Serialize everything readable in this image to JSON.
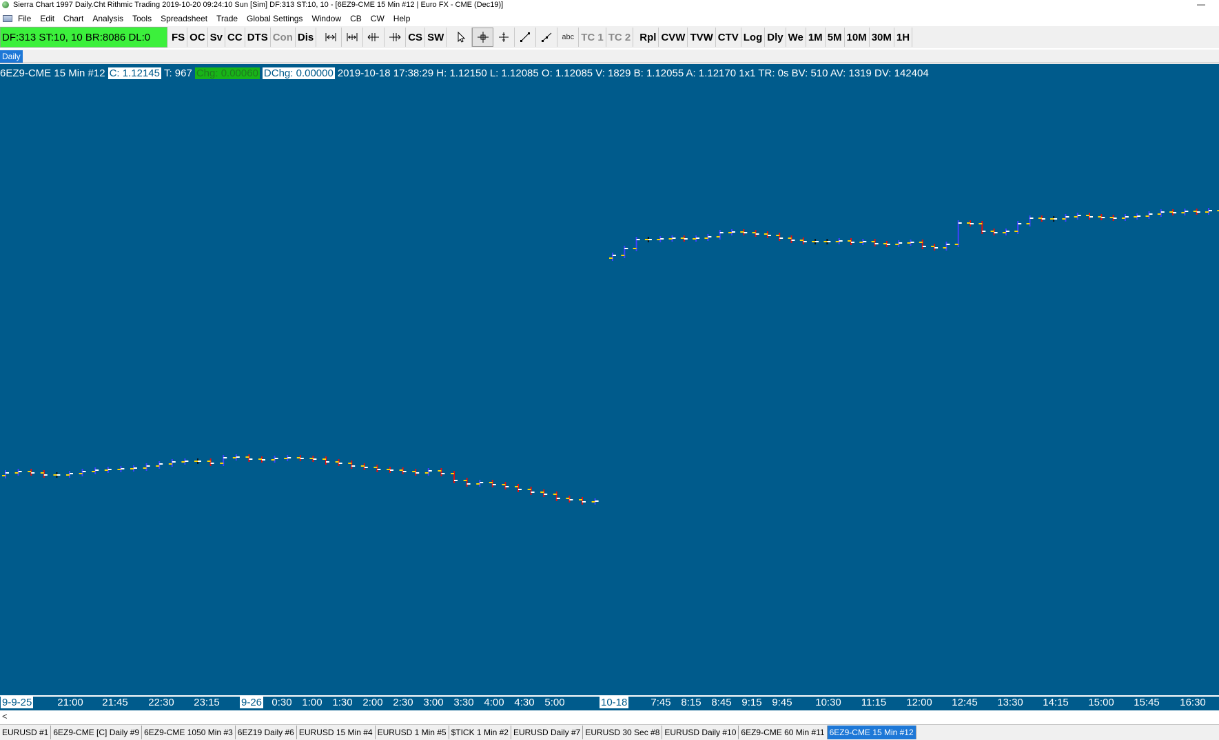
{
  "window": {
    "title": "Sierra Chart 1997 Daily.Cht  Rithmic Trading 2019-10-20  09:24:10 Sun [Sim]  DF:313  ST:10, 10 - [6EZ9-CME  15 Min  #12 | Euro FX - CME (Dec19)]",
    "minimize_glyph": "—"
  },
  "menu": [
    "File",
    "Edit",
    "Chart",
    "Analysis",
    "Tools",
    "Spreadsheet",
    "Trade",
    "Global Settings",
    "Window",
    "CB",
    "CW",
    "Help"
  ],
  "toolbar": {
    "status": "DF:313  ST:10, 10  BR:8086  DL:0",
    "status_color": "#3cf03c",
    "buttons_a": [
      {
        "label": "FS",
        "dim": false
      },
      {
        "label": "OC",
        "dim": false
      },
      {
        "label": "Sv",
        "dim": false
      },
      {
        "label": "CC",
        "dim": false
      },
      {
        "label": "DTS",
        "dim": false
      },
      {
        "label": "Con",
        "dim": true
      },
      {
        "label": "Dis",
        "dim": false
      }
    ],
    "icons": [
      "scale-range-icon",
      "scale-range-fixed-icon",
      "scroll-left-icon",
      "scroll-right-icon"
    ],
    "buttons_b": [
      {
        "label": "CS",
        "dim": false
      },
      {
        "label": "SW",
        "dim": false
      }
    ],
    "tools": [
      "pointer-icon",
      "crosshair-icon",
      "cursor-cross-icon",
      "draw-line-icon",
      "draw-ray-icon"
    ],
    "text_tool": "abc",
    "buttons_c": [
      {
        "label": "TC 1",
        "dim": true
      },
      {
        "label": "TC 2",
        "dim": true
      }
    ],
    "buttons_d": [
      {
        "label": "Rpl",
        "dim": false
      },
      {
        "label": "CVW",
        "dim": false
      },
      {
        "label": "TVW",
        "dim": false
      },
      {
        "label": "CTV",
        "dim": false
      },
      {
        "label": "Log",
        "dim": false
      },
      {
        "label": "Dly",
        "dim": false
      },
      {
        "label": "We",
        "dim": false
      },
      {
        "label": "1M",
        "dim": false
      },
      {
        "label": "5M",
        "dim": false
      },
      {
        "label": "10M",
        "dim": false
      },
      {
        "label": "30M",
        "dim": false
      },
      {
        "label": "1H",
        "dim": false
      }
    ]
  },
  "chart_tab": "Daily",
  "quote": {
    "symbol": "6EZ9-CME  15 Min  #12",
    "close": "C: 1.12145",
    "trades": "T: 967",
    "chg": "Chg: 0.00060",
    "dchg": "DChg: 0.00000",
    "details": "2019-10-18 17:38:29 H: 1.12150 L: 1.12085 O: 1.12085 V: 1829 B: 1.12055 A: 1.12170 1x1 TR: 0s BV: 510 AV: 1319 DV: 142404"
  },
  "colors": {
    "background": "#005b8c",
    "up": "#4040ff",
    "down": "#e01010",
    "neutral": "#111111",
    "open_tick": "#ffd400",
    "close_tick": "#ffffff"
  },
  "time_axis": [
    {
      "label": "9-9-25",
      "boxed": true
    },
    {
      "label": "21:00"
    },
    {
      "label": "21:45"
    },
    {
      "label": "22:30"
    },
    {
      "label": "23:15"
    },
    {
      "label": "9-26",
      "boxed": true
    },
    {
      "label": "0:30"
    },
    {
      "label": "1:00"
    },
    {
      "label": "1:30"
    },
    {
      "label": "2:00"
    },
    {
      "label": "2:30"
    },
    {
      "label": "3:00"
    },
    {
      "label": "3:30"
    },
    {
      "label": "4:00"
    },
    {
      "label": "4:30"
    },
    {
      "label": "5:00"
    },
    {
      "label": "10-18",
      "boxed": true
    },
    {
      "label": "7:45"
    },
    {
      "label": "8:15"
    },
    {
      "label": "8:45"
    },
    {
      "label": "9:15"
    },
    {
      "label": "9:45"
    },
    {
      "label": "10:30"
    },
    {
      "label": "11:15"
    },
    {
      "label": "12:00"
    },
    {
      "label": "12:45"
    },
    {
      "label": "13:30"
    },
    {
      "label": "14:15"
    },
    {
      "label": "15:00"
    },
    {
      "label": "15:45"
    },
    {
      "label": "16:30"
    }
  ],
  "scroll_arrow": "<",
  "bottom_tabs": [
    {
      "label": "EURUSD  #1"
    },
    {
      "label": "6EZ9-CME [C]  Daily  #9"
    },
    {
      "label": "6EZ9-CME  1050 Min  #3"
    },
    {
      "label": "6EZ19  Daily  #6"
    },
    {
      "label": "EURUSD  15 Min  #4"
    },
    {
      "label": "EURUSD  1 Min  #5"
    },
    {
      "label": "$TICK  1 Min  #2"
    },
    {
      "label": "EURUSD  Daily  #7"
    },
    {
      "label": "EURUSD  30 Sec  #8"
    },
    {
      "label": "EURUSD  Daily  #10"
    },
    {
      "label": "6EZ9-CME  60 Min  #11"
    },
    {
      "label": "6EZ9-CME  15 Min  #12",
      "active": true
    }
  ],
  "chart_data": {
    "type": "ohlc",
    "segments": [
      {
        "session": "9-25 / 9-26",
        "closes": [
          594,
          592,
          594,
          597,
          597,
          595,
          592,
          590,
          589,
          588,
          587,
          584,
          581,
          578,
          577,
          577,
          580,
          572,
          571,
          574,
          575,
          573,
          572,
          573,
          574,
          578,
          580,
          584,
          586,
          589,
          590,
          592,
          594,
          591,
          595,
          605,
          610,
          608,
          611,
          614,
          618,
          622,
          625,
          631,
          633,
          636,
          635
        ]
      },
      {
        "session": "10-18",
        "closes": [
          278,
          268,
          255,
          255,
          254,
          253,
          254,
          253,
          251,
          245,
          244,
          245,
          247,
          249,
          253,
          256,
          258,
          258,
          258,
          257,
          259,
          258,
          261,
          262,
          260,
          259,
          265,
          267,
          262,
          231,
          232,
          243,
          245,
          243,
          232,
          224,
          225,
          225,
          222,
          220,
          222,
          223,
          224,
          222,
          221,
          218,
          215,
          216,
          214,
          215,
          213,
          212,
          211,
          212,
          210,
          197
        ]
      }
    ]
  }
}
